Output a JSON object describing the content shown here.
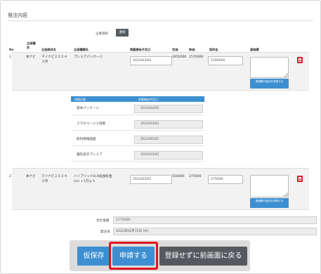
{
  "section": {
    "title": "発注内容"
  },
  "select_area": {
    "label": "企業選択",
    "button": "選択"
  },
  "table": {
    "headers": {
      "no": "No",
      "cat_top": "企画種",
      "cat_bottom": "別",
      "media": "企画媒体名",
      "product": "企画種類名",
      "start": "掲載開始予定日",
      "list_price": "定価",
      "rate": "卸価",
      "contract": "契約金",
      "notes": "連絡欄"
    },
    "rows": [
      {
        "no": "1",
        "cat": "本ナビ",
        "media_line1": "マイナビ２０２４",
        "media_line2": "３月",
        "product": "プレミアパッケージ",
        "start": "2023/03/01",
        "list_price": "2950000",
        "rate": "1570000",
        "contract": "1500000",
        "note_button": "連絡欄の転記を参照する"
      },
      {
        "no": "2",
        "cat": "本ナビ",
        "media_line1": "マイナビ２０２４",
        "media_line2": "３月",
        "product_line1": "ハイブリッドD-H延長料金",
        "product_line2": "(m) ＋1万ｐｔ",
        "start": "2023/03/01",
        "list_price": "550000",
        "rate": "275000",
        "contract": "275000",
        "note_button": "連絡欄の転記を参照する"
      }
    ]
  },
  "subtable": {
    "headers": {
      "name": "詳細企業",
      "date": "掲載開始予定日"
    },
    "rows": [
      {
        "name": "基本パッケージ",
        "date": "2023/03/01"
      },
      {
        "name": "スマホページ２倍版",
        "date": "2023/03/01"
      },
      {
        "name": "取材情報画面",
        "date": "2023/05/01"
      },
      {
        "name": "優先表示プレミア",
        "date": "2023/03/01"
      }
    ]
  },
  "footer": {
    "total_label": "合計金額",
    "total_value": "1775000",
    "order_date_label": "発注日",
    "order_date_value": "2022年06月15日 (水)"
  },
  "actions": {
    "draft": "仮保存",
    "apply": "申請する",
    "back": "登録せずに前画面に戻る"
  },
  "colors": {
    "draft_bg": "#3d8fd1",
    "apply_bg": "#3d8fd1",
    "back_bg": "#55595e",
    "highlight": "#e0141e"
  }
}
